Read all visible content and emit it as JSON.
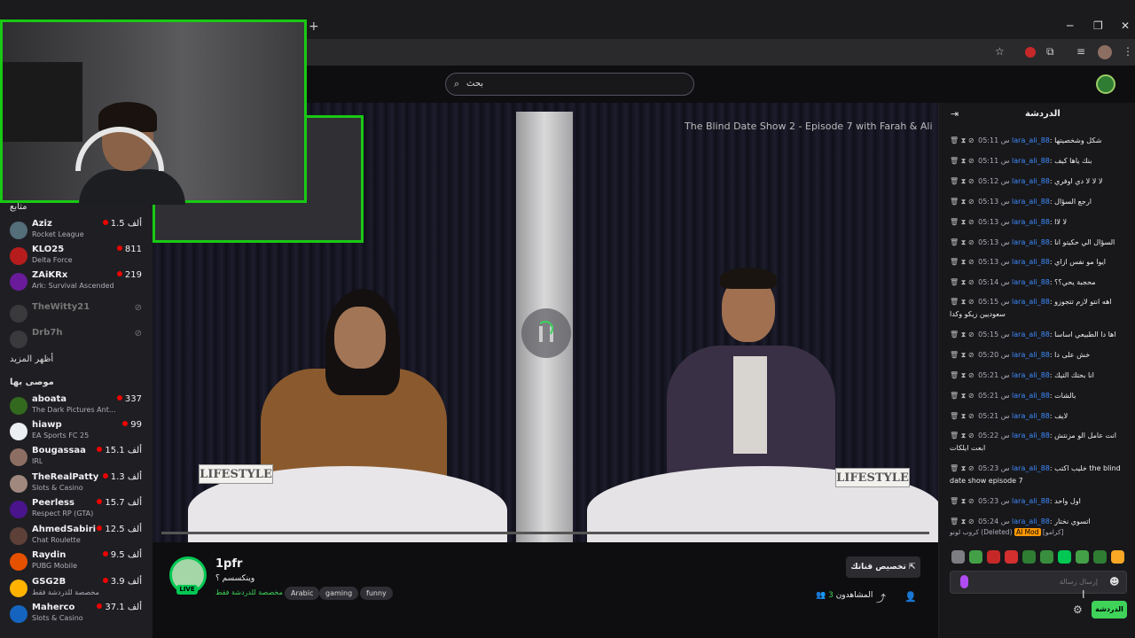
{
  "browser": {
    "new_tab_glyph": "+",
    "minimize": "─",
    "restore": "❐",
    "close": "✕",
    "star": "☆",
    "puzzle": "⧉",
    "menu": "⋮"
  },
  "header": {
    "search_placeholder": "بحث"
  },
  "sidebar": {
    "section_following": "متابع",
    "following": [
      {
        "name": "Aziz",
        "game": "Rocket League",
        "viewers": "1.5 ألف",
        "online": true
      },
      {
        "name": "KLO25",
        "game": "Delta Force",
        "viewers": "811",
        "online": true
      },
      {
        "name": "ZAiKRx",
        "game": "Ark: Survival Ascended",
        "viewers": "219",
        "online": true
      },
      {
        "name": "TheWitty21",
        "game": "",
        "viewers": "",
        "online": false
      },
      {
        "name": "Drb7h",
        "game": "",
        "viewers": "",
        "online": false
      }
    ],
    "show_more": "أظهر المزيد",
    "section_recommended": "موصى بها",
    "recommended": [
      {
        "name": "aboata",
        "game": "The Dark Pictures Ant...",
        "viewers": "337"
      },
      {
        "name": "hiawp",
        "game": "EA Sports FC 25",
        "viewers": "99"
      },
      {
        "name": "Bougassaa",
        "game": "IRL",
        "viewers": "15.1 ألف"
      },
      {
        "name": "TheRealPatty",
        "game": "Slots & Casino",
        "viewers": "1.3 ألف"
      },
      {
        "name": "Peerless",
        "game": "Respect RP (GTA)",
        "viewers": "15.7 ألف"
      },
      {
        "name": "AhmedSabiri",
        "game": "Chat Roulette",
        "viewers": "12.5 ألف"
      },
      {
        "name": "Raydin",
        "game": "PUBG Mobile",
        "viewers": "9.5 ألف"
      },
      {
        "name": "GSG2B",
        "game": "مخصصة للدردشة فقط",
        "viewers": "3.9 ألف"
      },
      {
        "name": "Maherco",
        "game": "Slots & Casino",
        "viewers": "37.1 ألف"
      }
    ]
  },
  "video": {
    "title": "The Blind Date Show 2 - Episode 7 with Farah & Ali",
    "placard": "LIFESTYLE",
    "progress": 0.04
  },
  "stream": {
    "name": "1pfr",
    "live": "LIVE",
    "title": "وينكسسم ؟",
    "category": "مخصصة للدردشة فقط",
    "tags": [
      "Arabic",
      "gaming",
      "funny"
    ],
    "customize": "تخصيص قناتك",
    "viewers_label": "المشاهدون",
    "viewers_count": "3"
  },
  "chat": {
    "title": "الدردشة",
    "messages": [
      {
        "time": "05:11",
        "prefix": "س",
        "user": "lara_ali_88",
        "text": "شكل وشخصيتها"
      },
      {
        "time": "05:11",
        "prefix": "س",
        "user": "lara_ali_88",
        "text": "بنك ياها كيف"
      },
      {
        "time": "05:12",
        "prefix": "س",
        "user": "lara_ali_88",
        "text": "لا لا لا دي اوفري"
      },
      {
        "time": "05:13",
        "prefix": "س",
        "user": "lara_ali_88",
        "text": "ارجع السؤال"
      },
      {
        "time": "05:13",
        "prefix": "س",
        "user": "lara_ali_88",
        "text": "لا لاا"
      },
      {
        "time": "05:13",
        "prefix": "س",
        "user": "lara_ali_88",
        "text": "السؤال الي حكيتو انا"
      },
      {
        "time": "05:13",
        "prefix": "س",
        "user": "lara_ali_88",
        "text": "ايوا مو نفس ازاي"
      },
      {
        "time": "05:14",
        "prefix": "س",
        "user": "lara_ali_88",
        "text": "محجبة يحي؟؟"
      },
      {
        "time": "05:15",
        "prefix": "س",
        "user": "lara_ali_88",
        "text": "اهه انتو لازم تتجوزو سعوديين زيكو وكدا"
      },
      {
        "time": "05:15",
        "prefix": "س",
        "user": "lara_ali_88",
        "text": "اها دا الطبيعي اساسا"
      },
      {
        "time": "05:20",
        "prefix": "س",
        "user": "lara_ali_88",
        "text": "خش على دا"
      },
      {
        "time": "05:21",
        "prefix": "س",
        "user": "lara_ali_88",
        "text": "انا بحتك التيك"
      },
      {
        "time": "05:21",
        "prefix": "س",
        "user": "lara_ali_88",
        "text": "بالشات"
      },
      {
        "time": "05:21",
        "prefix": "س",
        "user": "lara_ali_88",
        "text": "لايف"
      },
      {
        "time": "05:22",
        "prefix": "س",
        "user": "lara_ali_88",
        "text": "انت عامل الو مزنتش ابعت ايلكات"
      },
      {
        "time": "05:23",
        "prefix": "س",
        "user": "lara_ali_88",
        "text": "خليب اكتب the blind date show episode 7"
      },
      {
        "time": "05:23",
        "prefix": "س",
        "user": "lara_ali_88",
        "text": "اول واحد"
      },
      {
        "time": "05:24",
        "prefix": "س",
        "user": "lara_ali_88",
        "text": "اتسوي نختار"
      }
    ],
    "deleted_row": {
      "name": "[كرامو]",
      "badge": "AI Mod",
      "status": "(Deleted)",
      "text": "كروب لونو"
    },
    "input_placeholder": "إرسال رسالة",
    "send_label": "الدردشة"
  },
  "colors": {
    "accent": "#3fd35a",
    "webcam_border": "#19c914",
    "live_red": "#eb0400",
    "username": "#3d8bfd",
    "mod_badge": "#ff9800"
  }
}
